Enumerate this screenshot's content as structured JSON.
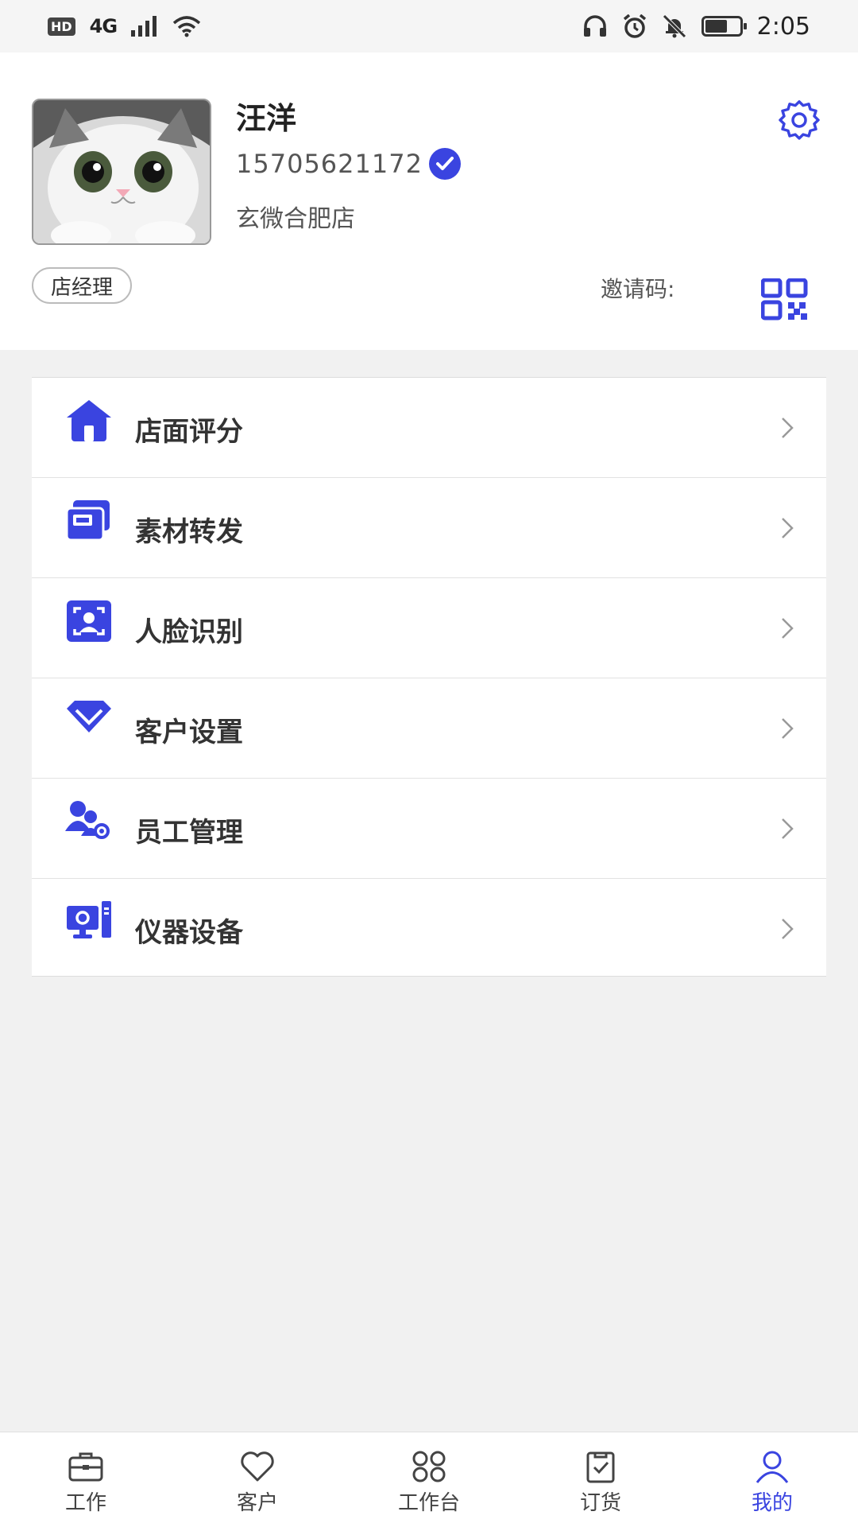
{
  "status_bar": {
    "hd": "HD",
    "network": "4G",
    "time": "2:05",
    "battery_level": 0.62
  },
  "profile": {
    "name": "汪洋",
    "phone": "15705621172",
    "store": "玄微合肥店",
    "role": "店经理",
    "invite_label": "邀请码:"
  },
  "menu": [
    {
      "label": "店面评分",
      "icon": "store-home-icon"
    },
    {
      "label": "素材转发",
      "icon": "material-forward-icon"
    },
    {
      "label": "人脸识别",
      "icon": "face-recognition-icon"
    },
    {
      "label": "客户设置",
      "icon": "customer-settings-icon"
    },
    {
      "label": "员工管理",
      "icon": "staff-management-icon"
    },
    {
      "label": "仪器设备",
      "icon": "equipment-icon"
    }
  ],
  "nav": [
    {
      "label": "工作",
      "icon": "briefcase-icon",
      "active": false
    },
    {
      "label": "客户",
      "icon": "heart-icon",
      "active": false
    },
    {
      "label": "工作台",
      "icon": "grid-icon",
      "active": false
    },
    {
      "label": "订货",
      "icon": "clipboard-check-icon",
      "active": false
    },
    {
      "label": "我的",
      "icon": "person-icon",
      "active": true
    }
  ],
  "colors": {
    "accent": "#3a44e0",
    "background": "#f1f1f1"
  }
}
